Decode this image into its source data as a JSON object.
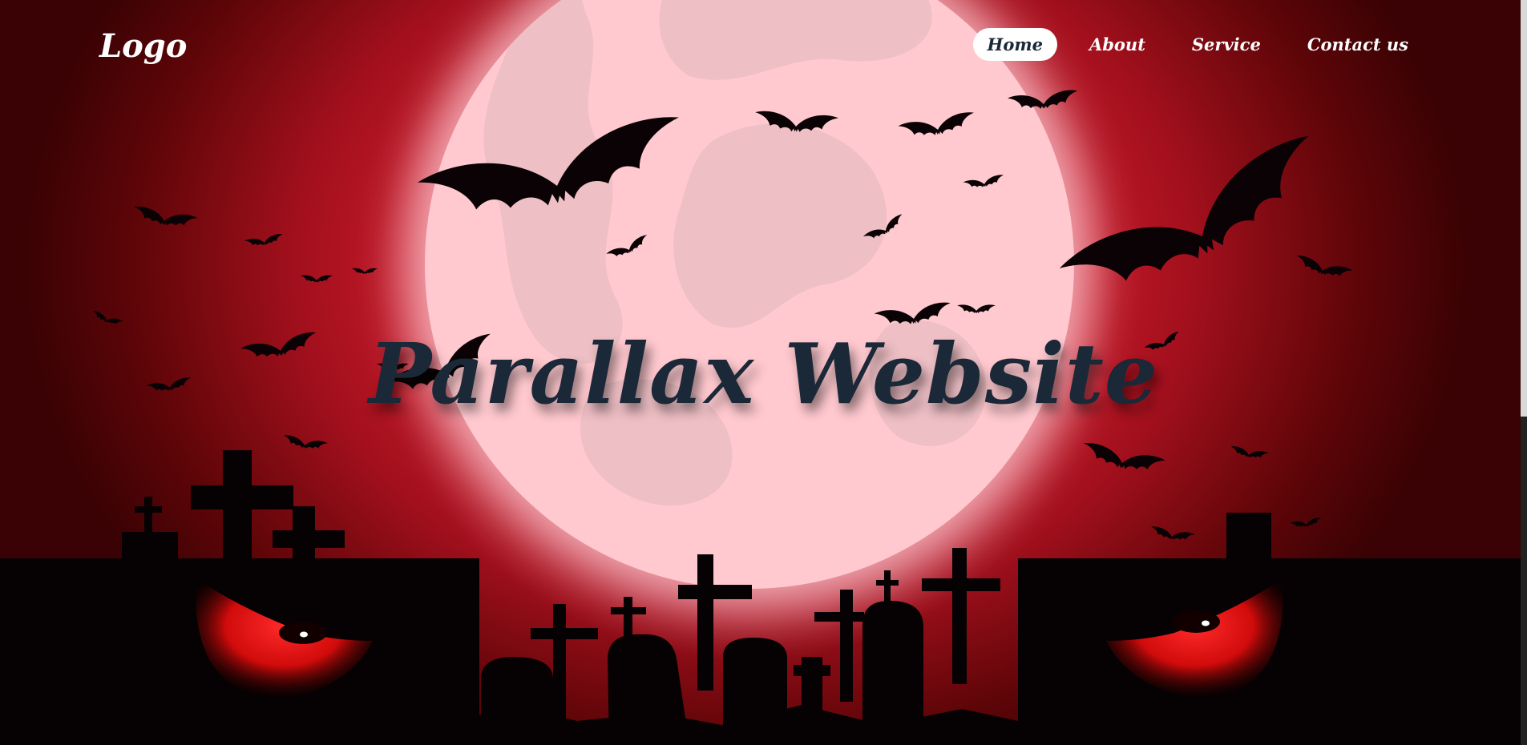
{
  "header": {
    "logo": "Logo",
    "nav": [
      {
        "label": "Home",
        "active": true
      },
      {
        "label": "About",
        "active": false
      },
      {
        "label": "Service",
        "active": false
      },
      {
        "label": "Contact us",
        "active": false
      }
    ]
  },
  "hero": {
    "title": "Parallax Website"
  },
  "colors": {
    "background": "#d81d2e",
    "moon": "#ffc9cf",
    "title": "#1b2838",
    "nav_active_bg": "#ffffff"
  },
  "icons": [
    "bat-icon",
    "cross-tombstone-icon",
    "evil-eye-icon",
    "moon-icon"
  ]
}
